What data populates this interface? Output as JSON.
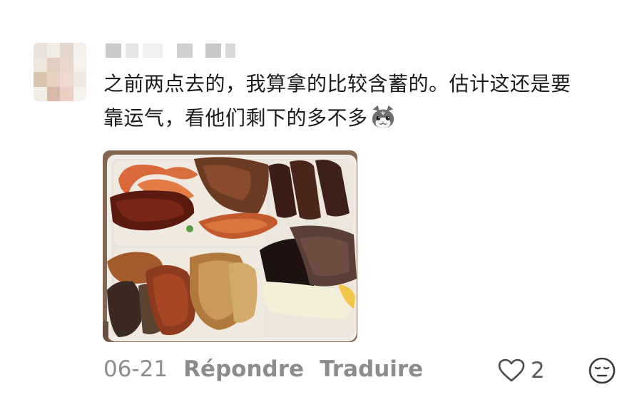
{
  "comment": {
    "author": {
      "avatar": "blurred-avatar",
      "name_blurred": true
    },
    "text_line1": "之前两点去的，我算拿的比较含蓄的。估计这还是要",
    "text_line2": "靠运气，看他们剩下的多不多",
    "emoji": "cat-face-emoji",
    "photo": "food-tray-photo"
  },
  "footer": {
    "date": "06-21",
    "reply_label": "Répondre",
    "translate_label": "Traduire",
    "like_count": "2",
    "like_icon": "heart-outline-icon",
    "dislike_icon": "neutral-face-icon"
  },
  "colors": {
    "text_primary": "#1a1a1a",
    "text_secondary": "#8c8c8c",
    "like_count": "#5a5a5a"
  }
}
